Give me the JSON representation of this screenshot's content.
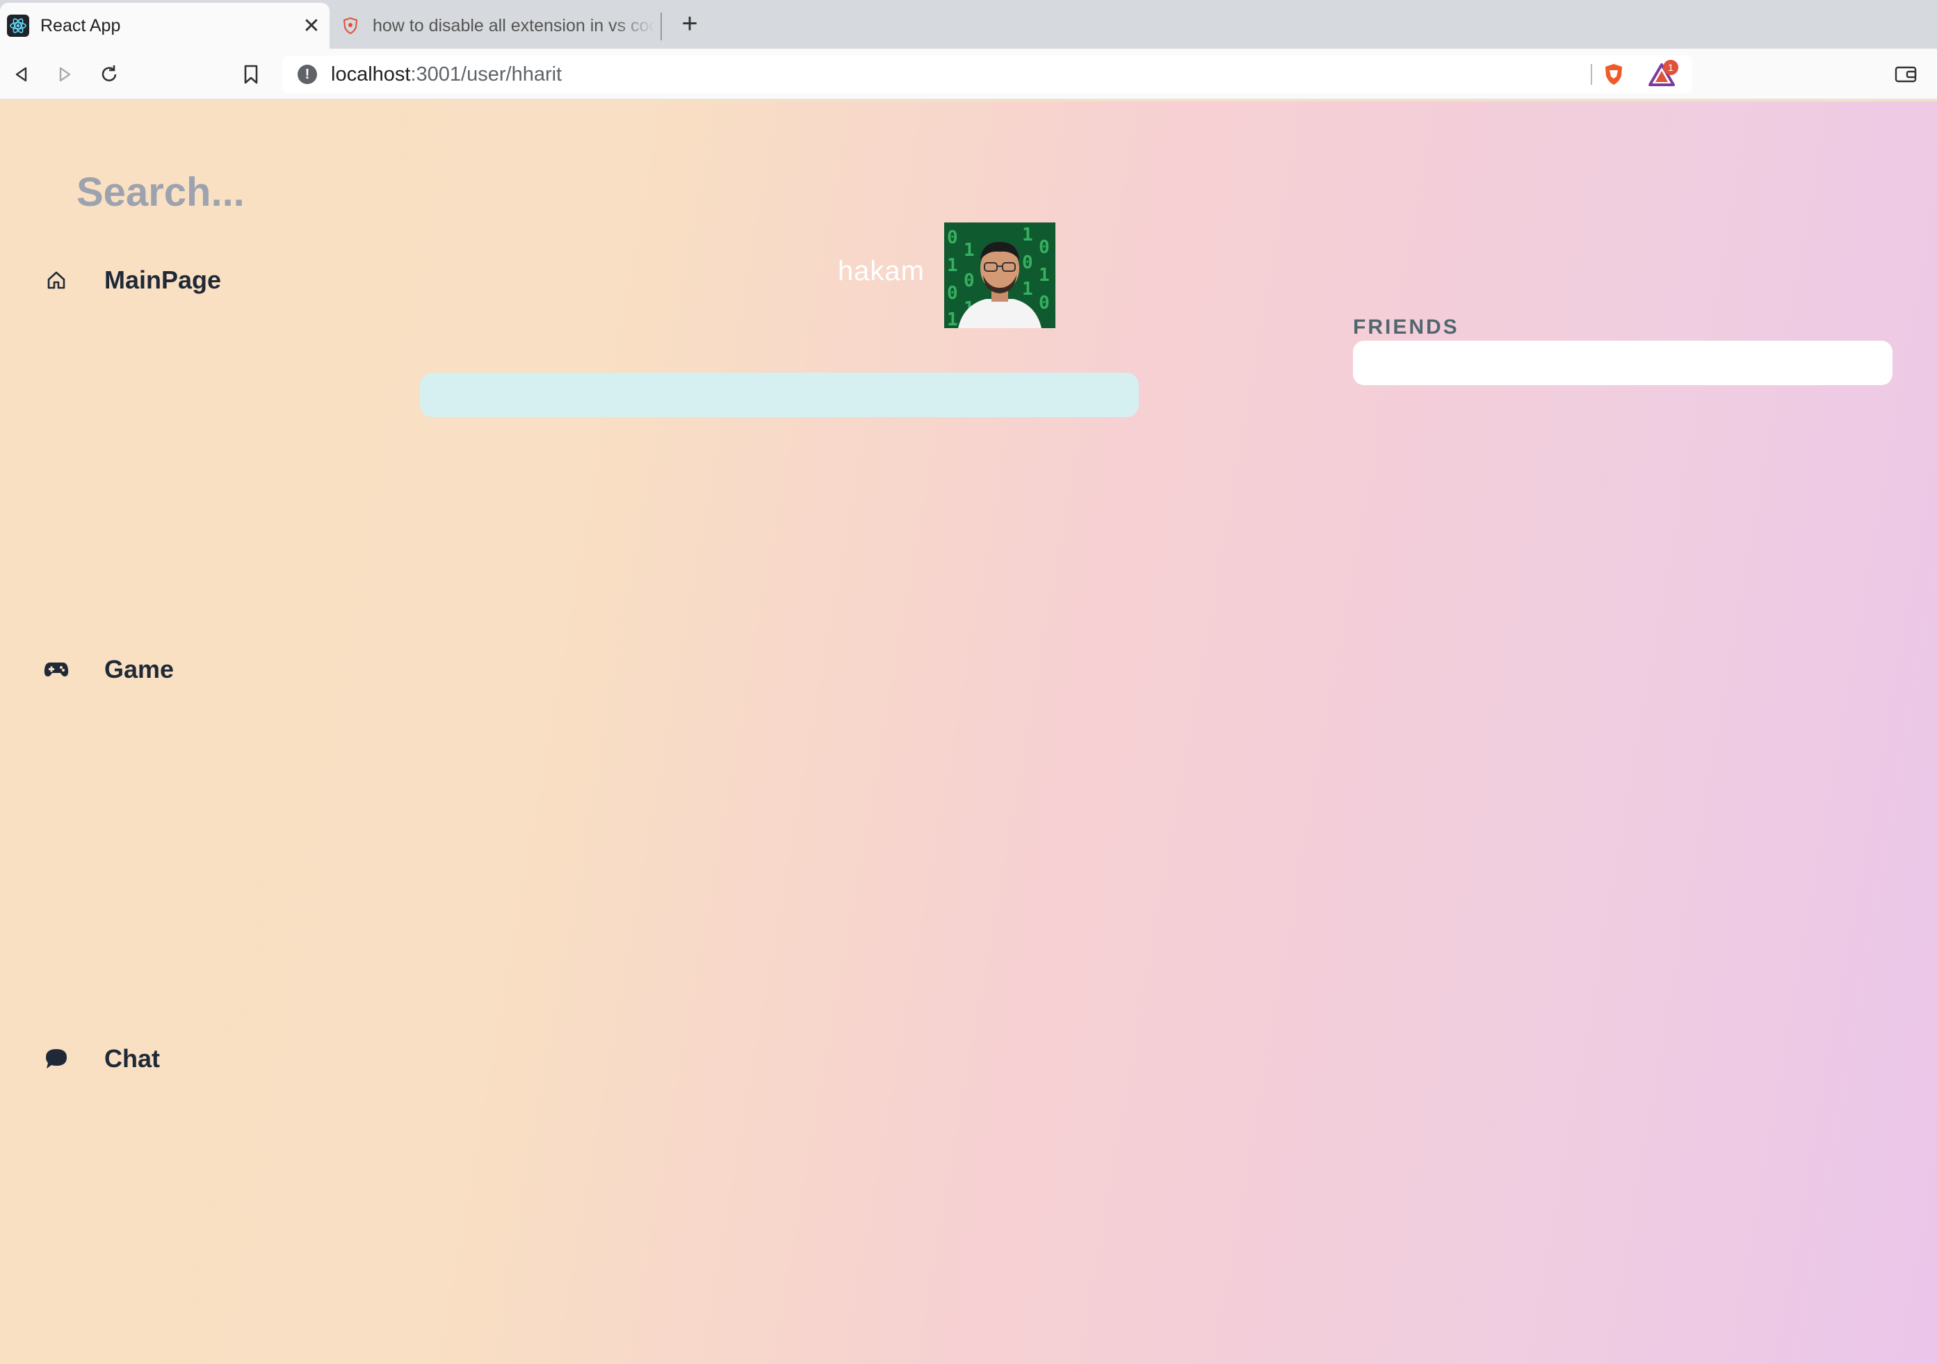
{
  "browser": {
    "tabs": [
      {
        "title": "React App",
        "active": true,
        "favicon": "react-logo-icon"
      },
      {
        "title": "how to disable all extension in vs code",
        "active": false,
        "favicon": "brave-shield-icon"
      }
    ],
    "new_tab_icon": "plus-icon",
    "url_host": "localhost",
    "url_path": ":3001/user/hharit",
    "rewards_badge_count": "1"
  },
  "search": {
    "placeholder": "Search...",
    "value": ""
  },
  "profile": {
    "name": "hakam",
    "level_progress": 0
  },
  "friends": {
    "label": "FRIENDS",
    "items": []
  },
  "nav": {
    "items": [
      {
        "label": "MainPage",
        "icon": "home-icon"
      },
      {
        "label": "Game",
        "icon": "gamepad-icon"
      },
      {
        "label": "Chat",
        "icon": "chat-bubble-icon"
      }
    ]
  },
  "colors": {
    "nav_text": "#1f2937",
    "progress_track": "#d6f0f1",
    "friends_label": "#516770",
    "gradient_start": "#fae0c2",
    "gradient_end": "#ebc6ea"
  }
}
